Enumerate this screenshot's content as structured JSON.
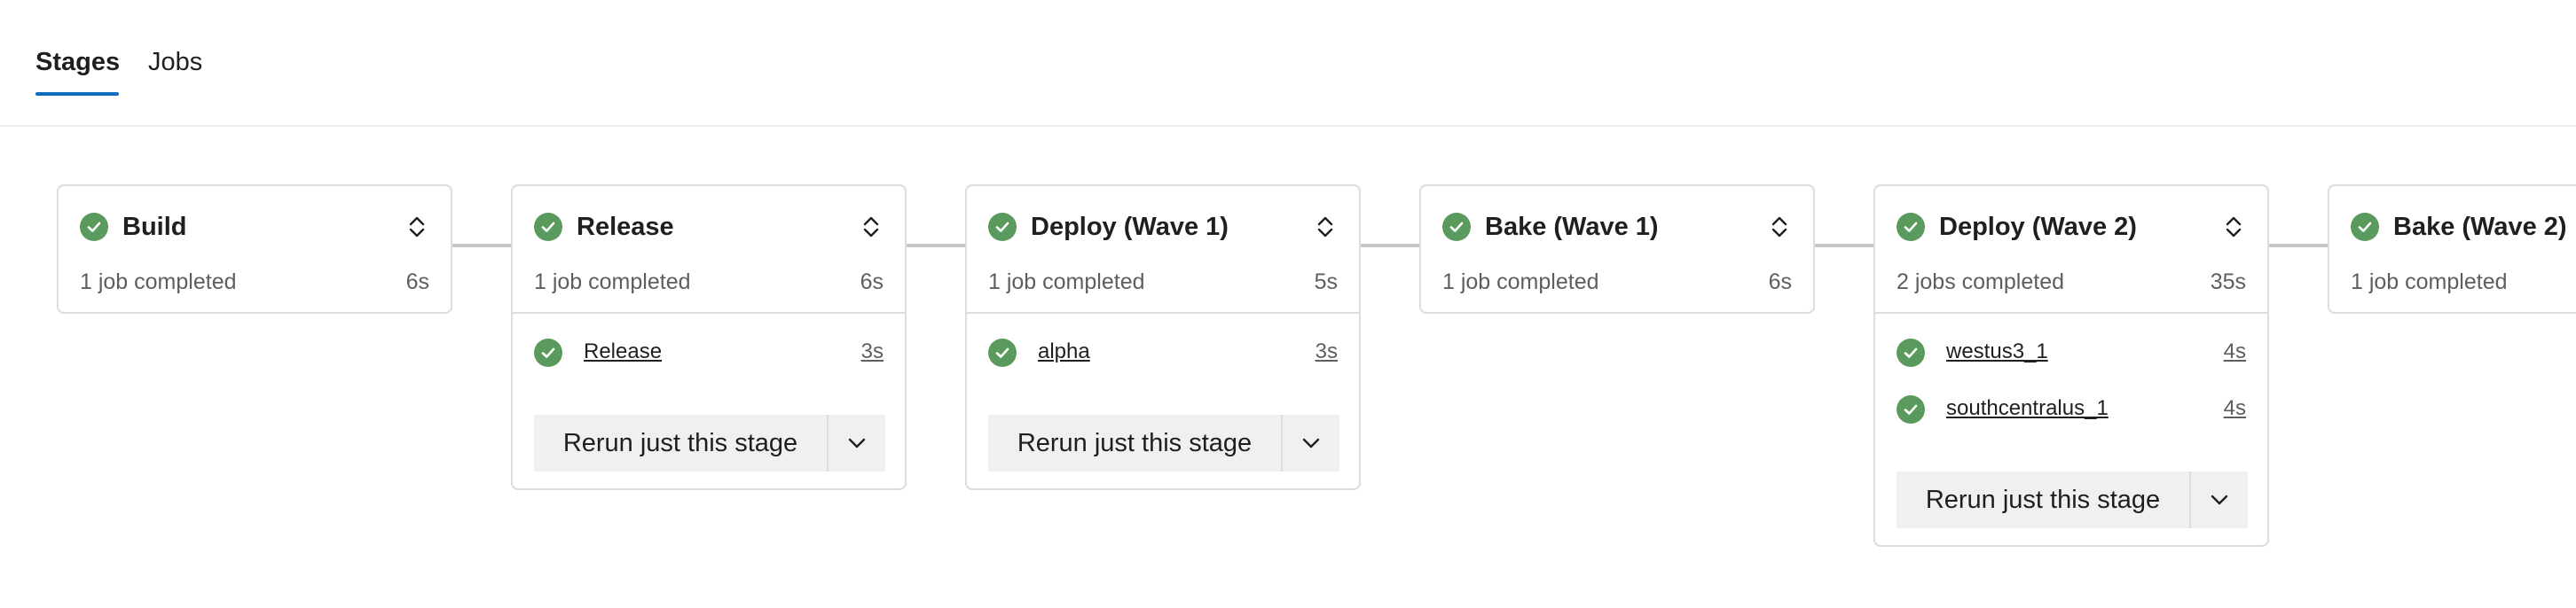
{
  "tabs": [
    {
      "label": "Stages",
      "active": true
    },
    {
      "label": "Jobs",
      "active": false
    }
  ],
  "colors": {
    "success": "#5a9a5c",
    "accent": "#0f6cbd"
  },
  "rerun_label": "Rerun just this stage",
  "stages": [
    {
      "title": "Build",
      "summary": "1 job completed",
      "duration": "6s",
      "status": "succeeded",
      "jobs": []
    },
    {
      "title": "Release",
      "summary": "1 job completed",
      "duration": "6s",
      "status": "succeeded",
      "jobs": [
        {
          "name": "Release",
          "duration": "3s",
          "status": "succeeded"
        }
      ]
    },
    {
      "title": "Deploy (Wave 1)",
      "summary": "1 job completed",
      "duration": "5s",
      "status": "succeeded",
      "jobs": [
        {
          "name": "alpha",
          "duration": "3s",
          "status": "succeeded"
        }
      ]
    },
    {
      "title": "Bake (Wave 1)",
      "summary": "1 job completed",
      "duration": "6s",
      "status": "succeeded",
      "jobs": []
    },
    {
      "title": "Deploy (Wave 2)",
      "summary": "2 jobs completed",
      "duration": "35s",
      "status": "succeeded",
      "jobs": [
        {
          "name": "westus3_1",
          "duration": "4s",
          "status": "succeeded"
        },
        {
          "name": "southcentralus_1",
          "duration": "4s",
          "status": "succeeded"
        }
      ]
    },
    {
      "title": "Bake (Wave 2)",
      "summary": "1 job completed",
      "duration": "",
      "status": "succeeded",
      "jobs": []
    }
  ]
}
